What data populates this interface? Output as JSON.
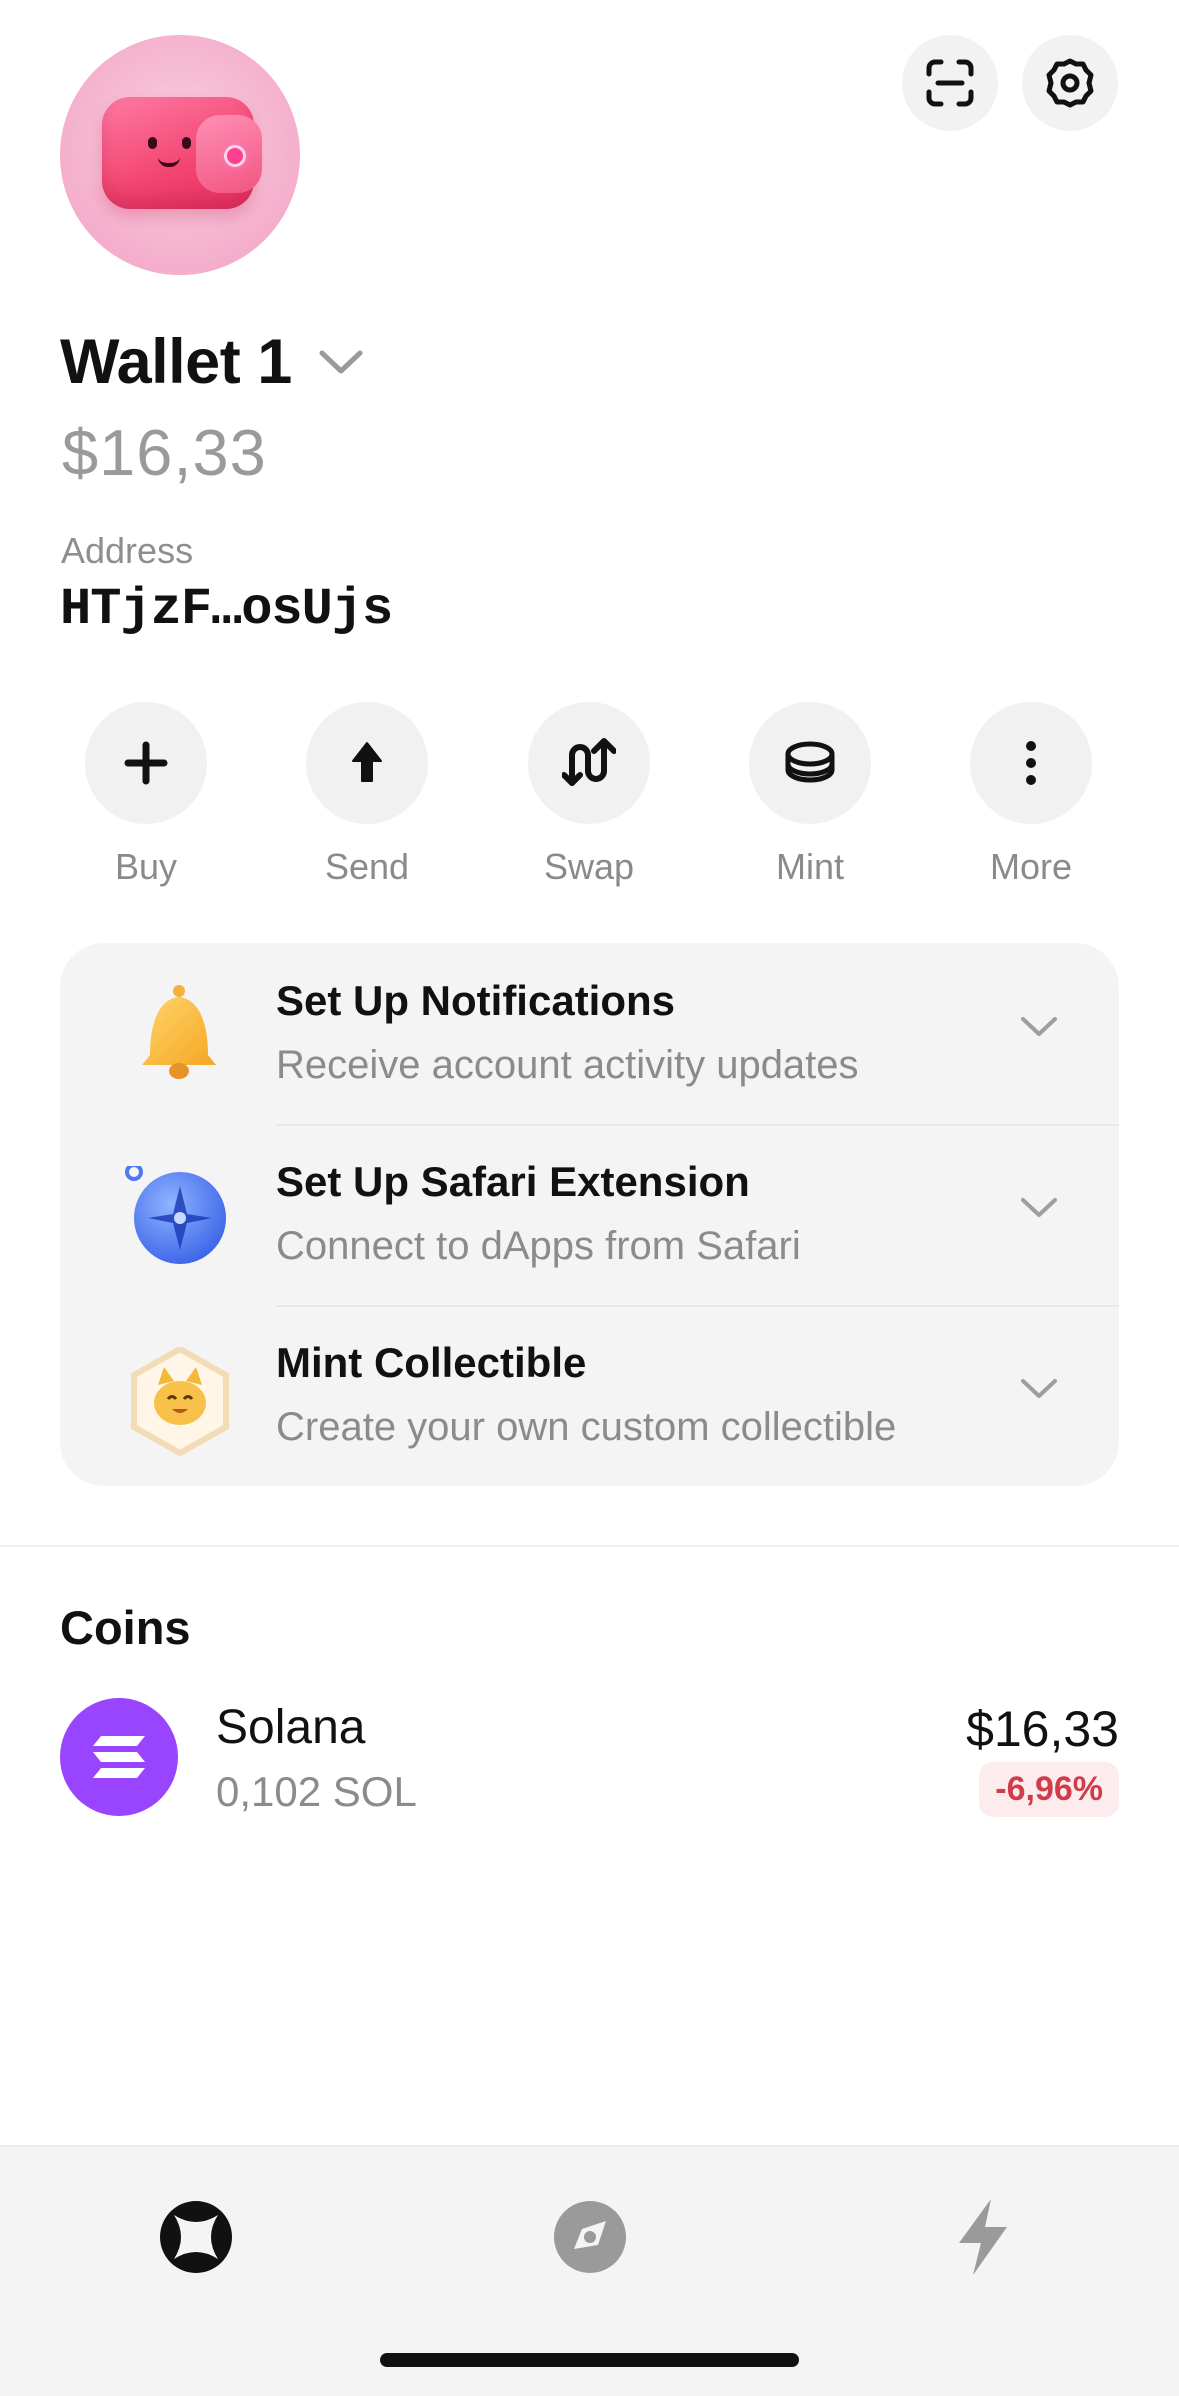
{
  "header": {
    "wallet_name": "Wallet 1",
    "balance": "$16,33",
    "address_label": "Address",
    "address_value": "HTjzF…osUjs",
    "scan_icon": "scan-qr-icon",
    "settings_icon": "gear-icon"
  },
  "actions": [
    {
      "label": "Buy",
      "icon": "plus-icon"
    },
    {
      "label": "Send",
      "icon": "arrow-up-icon"
    },
    {
      "label": "Swap",
      "icon": "swap-icon"
    },
    {
      "label": "Mint",
      "icon": "coin-stack-icon"
    },
    {
      "label": "More",
      "icon": "more-vertical-icon"
    }
  ],
  "setup": [
    {
      "title": "Set Up Notifications",
      "description": "Receive account activity updates",
      "icon": "bell-icon"
    },
    {
      "title": "Set Up Safari Extension",
      "description": "Connect to dApps from Safari",
      "icon": "compass-icon"
    },
    {
      "title": "Mint Collectible",
      "description": "Create your own custom collectible",
      "icon": "cat-collectible-icon"
    }
  ],
  "coins": {
    "title": "Coins",
    "items": [
      {
        "name": "Solana",
        "amount": "0,102 SOL",
        "value": "$16,33",
        "change": "-6,96%",
        "change_color": "#d23c4a",
        "logo_color": "#9945ff"
      }
    ]
  },
  "tabbar": {
    "tabs": [
      {
        "name": "home",
        "icon": "wallet-home-icon",
        "active": true
      },
      {
        "name": "explore",
        "icon": "explore-compass-icon",
        "active": false
      },
      {
        "name": "activity",
        "icon": "lightning-icon",
        "active": false
      }
    ]
  }
}
